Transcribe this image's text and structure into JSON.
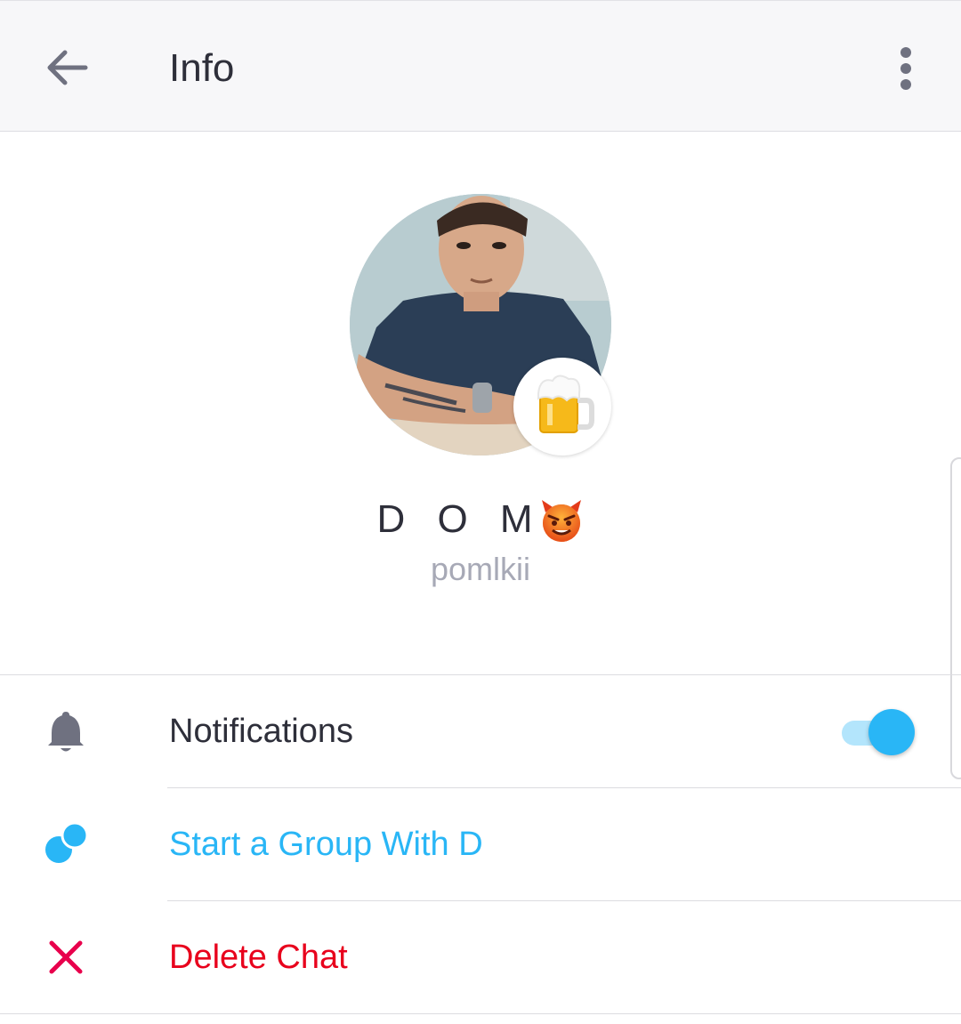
{
  "appbar": {
    "title": "Info",
    "back_icon": "arrow-left-icon",
    "more_icon": "more-vertical-icon"
  },
  "profile": {
    "name": "D O M",
    "name_emoji": "devil-face-icon",
    "username": "pomlkii",
    "status_icon": "beer-mug-icon"
  },
  "settings": {
    "notifications": {
      "label": "Notifications",
      "icon": "bell-icon",
      "enabled": true
    },
    "start_group": {
      "label": "Start a Group With D",
      "icon": "group-bubbles-icon"
    },
    "delete_chat": {
      "label": "Delete Chat",
      "icon": "close-icon"
    }
  },
  "colors": {
    "accent": "#29b6f6",
    "danger": "#e8001c",
    "text": "#2e2f3a",
    "muted": "#a7a9b6",
    "icon": "#6f7180"
  }
}
